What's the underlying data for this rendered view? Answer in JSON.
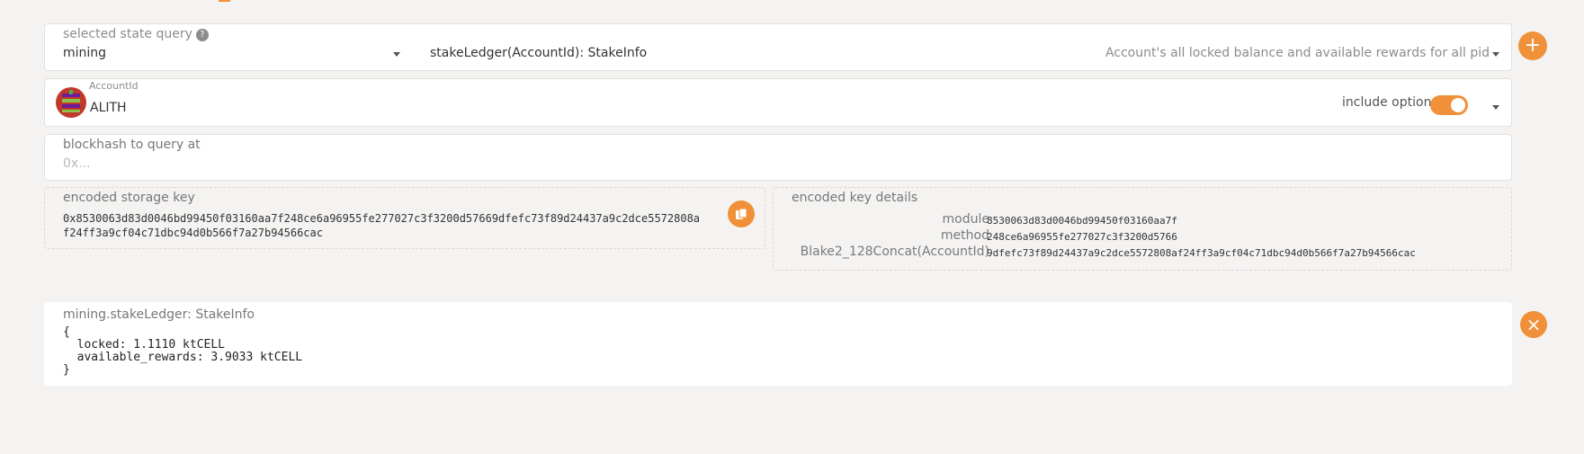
{
  "query": {
    "label": "selected state query",
    "help_icon": "?",
    "module": "mining",
    "method": "stakeLedger(AccountId): StakeInfo",
    "method_description": "Account's all locked balance and available rewards for all pid"
  },
  "account": {
    "label": "AccountId",
    "value": "ALITH",
    "include_option_label": "include option",
    "include_option_enabled": true
  },
  "blockhash": {
    "label": "blockhash to query at",
    "placeholder": "0x..."
  },
  "encoded_key": {
    "label": "encoded storage key",
    "line1": "0x8530063d83d0046bd99450f03160aa7f248ce6a96955fe277027c3f3200d57669dfefc73f89d24437a9c2dce5572808a",
    "line2": "f24ff3a9cf04c71dbc94d0b566f7a27b94566cac"
  },
  "key_details": {
    "label": "encoded key details",
    "rows": [
      {
        "key": "module",
        "value": "8530063d83d0046bd99450f03160aa7f"
      },
      {
        "key": "method",
        "value": "248ce6a96955fe277027c3f3200d5766"
      },
      {
        "key": "Blake2_128Concat(AccountId)",
        "value": "9dfefc73f89d24437a9c2dce5572808af24ff3a9cf04c71dbc94d0b566f7a27b94566cac"
      }
    ]
  },
  "result": {
    "title": "mining.stakeLedger: StakeInfo",
    "open_brace": "{",
    "line1": "  locked: 1.1110 ktCELL",
    "line2": "  available_rewards: 3.9033 ktCELL",
    "close_brace": "}"
  },
  "buttons": {
    "add": "+",
    "remove": "×",
    "copy_icon": "copy-icon"
  },
  "colors": {
    "accent": "#f0913a",
    "background": "#f4f3f2"
  }
}
